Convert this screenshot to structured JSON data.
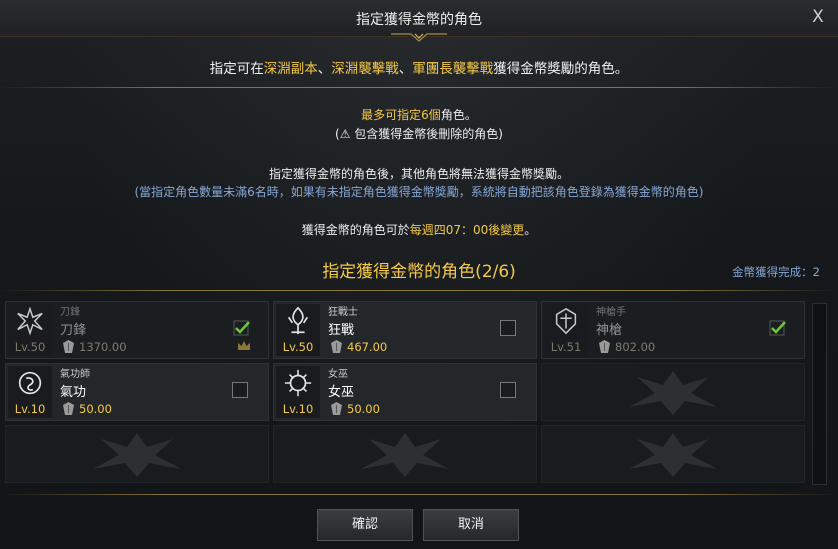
{
  "dialog": {
    "title": "指定獲得金幣的角色",
    "close_label": "X"
  },
  "intro": {
    "prefix": "指定可在",
    "content1": "深淵副本",
    "sep1": "、",
    "content2": "深淵襲擊戰",
    "sep2": "、",
    "content3": "軍團長襲擊戰",
    "suffix": "獲得金幣獎勵的角色。"
  },
  "limits": {
    "max_prefix": "最多可指定",
    "max_count": "6個",
    "max_suffix": "角色。",
    "note": "(⚠ 包含獲得金幣後刪除的角色)"
  },
  "rules": {
    "line1": "指定獲得金幣的角色後，其他角色將無法獲得金幣獎勵。",
    "line2": "(當指定角色數量未滿6名時，如果有未指定角色獲得金幣獎勵，系統將自動把該角色登錄為獲得金幣的角色)"
  },
  "change": {
    "prefix": "獲得金幣的角色可於",
    "time": "每週四07：00後變更",
    "suffix": "。"
  },
  "section": {
    "title": "指定獲得金幣的角色(2/6)",
    "completed_label": "金幣獲得完成：2"
  },
  "characters": [
    {
      "class": "刀鋒",
      "name": "刀鋒",
      "level": "Lv.50",
      "item_level": "1370.00",
      "state": "assigned",
      "checked": true,
      "crown": true
    },
    {
      "class": "狂戰士",
      "name": "狂戰",
      "level": "Lv.50",
      "item_level": "467.00",
      "state": "available",
      "checked": false,
      "crown": false
    },
    {
      "class": "神槍手",
      "name": "神槍",
      "level": "Lv.51",
      "item_level": "802.00",
      "state": "assigned",
      "checked": true,
      "crown": false
    },
    {
      "class": "氣功師",
      "name": "氣功",
      "level": "Lv.10",
      "item_level": "50.00",
      "state": "available",
      "checked": false,
      "crown": false
    },
    {
      "class": "女巫",
      "name": "女巫",
      "level": "Lv.10",
      "item_level": "50.00",
      "state": "available",
      "checked": false,
      "crown": false
    }
  ],
  "buttons": {
    "confirm": "確認",
    "cancel": "取消"
  },
  "colors": {
    "accent_gold": "#f4c84a",
    "info_blue": "#86a6d4",
    "check_green": "#6cc43a"
  }
}
